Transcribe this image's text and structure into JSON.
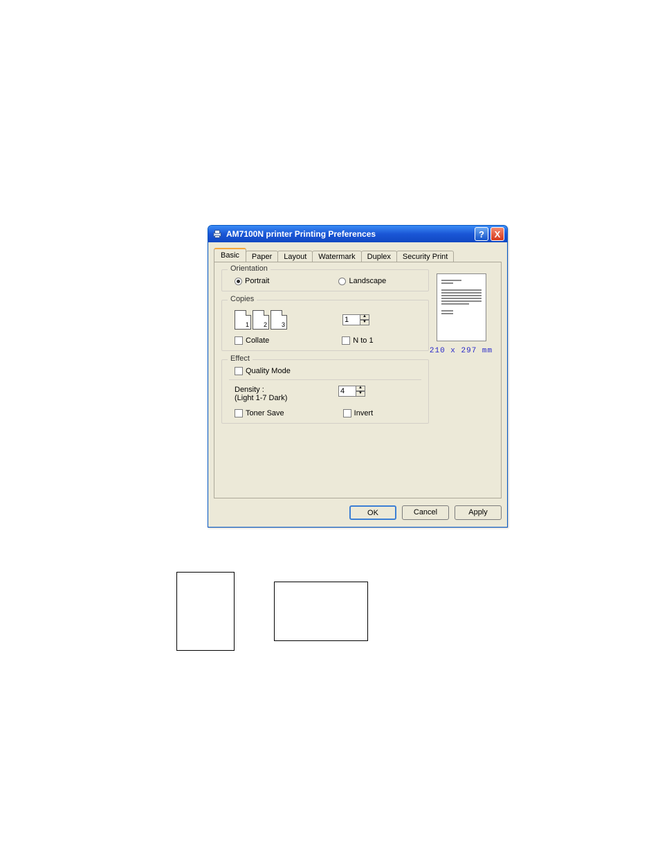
{
  "window": {
    "title": "AM7100N printer Printing Preferences"
  },
  "tabs": [
    {
      "label": "Basic"
    },
    {
      "label": "Paper"
    },
    {
      "label": "Layout"
    },
    {
      "label": "Watermark"
    },
    {
      "label": "Duplex"
    },
    {
      "label": "Security Print"
    }
  ],
  "orientation": {
    "legend": "Orientation",
    "portrait_label": "Portrait",
    "landscape_label": "Landscape"
  },
  "copies": {
    "legend": "Copies",
    "page1": "1",
    "page2": "2",
    "page3": "3",
    "count": "1",
    "collate_label": "Collate",
    "nto1_label": "N to 1"
  },
  "effect": {
    "legend": "Effect",
    "quality_label": "Quality Mode",
    "density_label": "Density :",
    "density_hint": "(Light 1-7 Dark)",
    "density_value": "4",
    "toner_save_label": "Toner Save",
    "invert_label": "Invert"
  },
  "preview": {
    "paper_size": "210 x 297 mm"
  },
  "buttons": {
    "ok": "OK",
    "cancel": "Cancel",
    "apply": "Apply"
  },
  "titlebar_icons": {
    "help": "?",
    "close": "X"
  }
}
